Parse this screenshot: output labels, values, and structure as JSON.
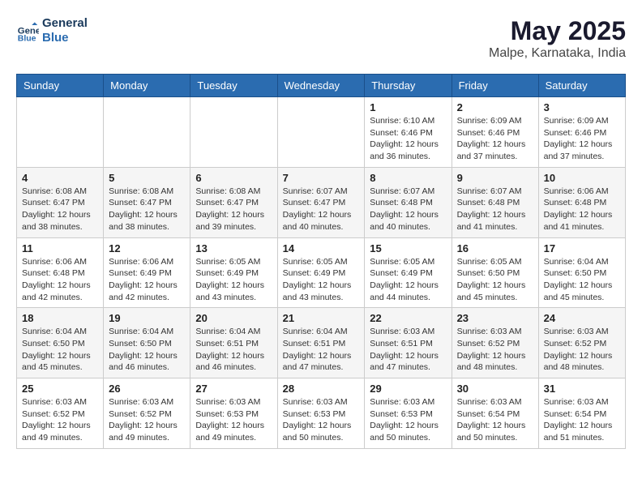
{
  "logo": {
    "line1": "General",
    "line2": "Blue"
  },
  "title": "May 2025",
  "location": "Malpe, Karnataka, India",
  "days_of_week": [
    "Sunday",
    "Monday",
    "Tuesday",
    "Wednesday",
    "Thursday",
    "Friday",
    "Saturday"
  ],
  "weeks": [
    [
      {
        "day": "",
        "info": ""
      },
      {
        "day": "",
        "info": ""
      },
      {
        "day": "",
        "info": ""
      },
      {
        "day": "",
        "info": ""
      },
      {
        "day": "1",
        "info": "Sunrise: 6:10 AM\nSunset: 6:46 PM\nDaylight: 12 hours\nand 36 minutes."
      },
      {
        "day": "2",
        "info": "Sunrise: 6:09 AM\nSunset: 6:46 PM\nDaylight: 12 hours\nand 37 minutes."
      },
      {
        "day": "3",
        "info": "Sunrise: 6:09 AM\nSunset: 6:46 PM\nDaylight: 12 hours\nand 37 minutes."
      }
    ],
    [
      {
        "day": "4",
        "info": "Sunrise: 6:08 AM\nSunset: 6:47 PM\nDaylight: 12 hours\nand 38 minutes."
      },
      {
        "day": "5",
        "info": "Sunrise: 6:08 AM\nSunset: 6:47 PM\nDaylight: 12 hours\nand 38 minutes."
      },
      {
        "day": "6",
        "info": "Sunrise: 6:08 AM\nSunset: 6:47 PM\nDaylight: 12 hours\nand 39 minutes."
      },
      {
        "day": "7",
        "info": "Sunrise: 6:07 AM\nSunset: 6:47 PM\nDaylight: 12 hours\nand 40 minutes."
      },
      {
        "day": "8",
        "info": "Sunrise: 6:07 AM\nSunset: 6:48 PM\nDaylight: 12 hours\nand 40 minutes."
      },
      {
        "day": "9",
        "info": "Sunrise: 6:07 AM\nSunset: 6:48 PM\nDaylight: 12 hours\nand 41 minutes."
      },
      {
        "day": "10",
        "info": "Sunrise: 6:06 AM\nSunset: 6:48 PM\nDaylight: 12 hours\nand 41 minutes."
      }
    ],
    [
      {
        "day": "11",
        "info": "Sunrise: 6:06 AM\nSunset: 6:48 PM\nDaylight: 12 hours\nand 42 minutes."
      },
      {
        "day": "12",
        "info": "Sunrise: 6:06 AM\nSunset: 6:49 PM\nDaylight: 12 hours\nand 42 minutes."
      },
      {
        "day": "13",
        "info": "Sunrise: 6:05 AM\nSunset: 6:49 PM\nDaylight: 12 hours\nand 43 minutes."
      },
      {
        "day": "14",
        "info": "Sunrise: 6:05 AM\nSunset: 6:49 PM\nDaylight: 12 hours\nand 43 minutes."
      },
      {
        "day": "15",
        "info": "Sunrise: 6:05 AM\nSunset: 6:49 PM\nDaylight: 12 hours\nand 44 minutes."
      },
      {
        "day": "16",
        "info": "Sunrise: 6:05 AM\nSunset: 6:50 PM\nDaylight: 12 hours\nand 45 minutes."
      },
      {
        "day": "17",
        "info": "Sunrise: 6:04 AM\nSunset: 6:50 PM\nDaylight: 12 hours\nand 45 minutes."
      }
    ],
    [
      {
        "day": "18",
        "info": "Sunrise: 6:04 AM\nSunset: 6:50 PM\nDaylight: 12 hours\nand 45 minutes."
      },
      {
        "day": "19",
        "info": "Sunrise: 6:04 AM\nSunset: 6:50 PM\nDaylight: 12 hours\nand 46 minutes."
      },
      {
        "day": "20",
        "info": "Sunrise: 6:04 AM\nSunset: 6:51 PM\nDaylight: 12 hours\nand 46 minutes."
      },
      {
        "day": "21",
        "info": "Sunrise: 6:04 AM\nSunset: 6:51 PM\nDaylight: 12 hours\nand 47 minutes."
      },
      {
        "day": "22",
        "info": "Sunrise: 6:03 AM\nSunset: 6:51 PM\nDaylight: 12 hours\nand 47 minutes."
      },
      {
        "day": "23",
        "info": "Sunrise: 6:03 AM\nSunset: 6:52 PM\nDaylight: 12 hours\nand 48 minutes."
      },
      {
        "day": "24",
        "info": "Sunrise: 6:03 AM\nSunset: 6:52 PM\nDaylight: 12 hours\nand 48 minutes."
      }
    ],
    [
      {
        "day": "25",
        "info": "Sunrise: 6:03 AM\nSunset: 6:52 PM\nDaylight: 12 hours\nand 49 minutes."
      },
      {
        "day": "26",
        "info": "Sunrise: 6:03 AM\nSunset: 6:52 PM\nDaylight: 12 hours\nand 49 minutes."
      },
      {
        "day": "27",
        "info": "Sunrise: 6:03 AM\nSunset: 6:53 PM\nDaylight: 12 hours\nand 49 minutes."
      },
      {
        "day": "28",
        "info": "Sunrise: 6:03 AM\nSunset: 6:53 PM\nDaylight: 12 hours\nand 50 minutes."
      },
      {
        "day": "29",
        "info": "Sunrise: 6:03 AM\nSunset: 6:53 PM\nDaylight: 12 hours\nand 50 minutes."
      },
      {
        "day": "30",
        "info": "Sunrise: 6:03 AM\nSunset: 6:54 PM\nDaylight: 12 hours\nand 50 minutes."
      },
      {
        "day": "31",
        "info": "Sunrise: 6:03 AM\nSunset: 6:54 PM\nDaylight: 12 hours\nand 51 minutes."
      }
    ]
  ]
}
